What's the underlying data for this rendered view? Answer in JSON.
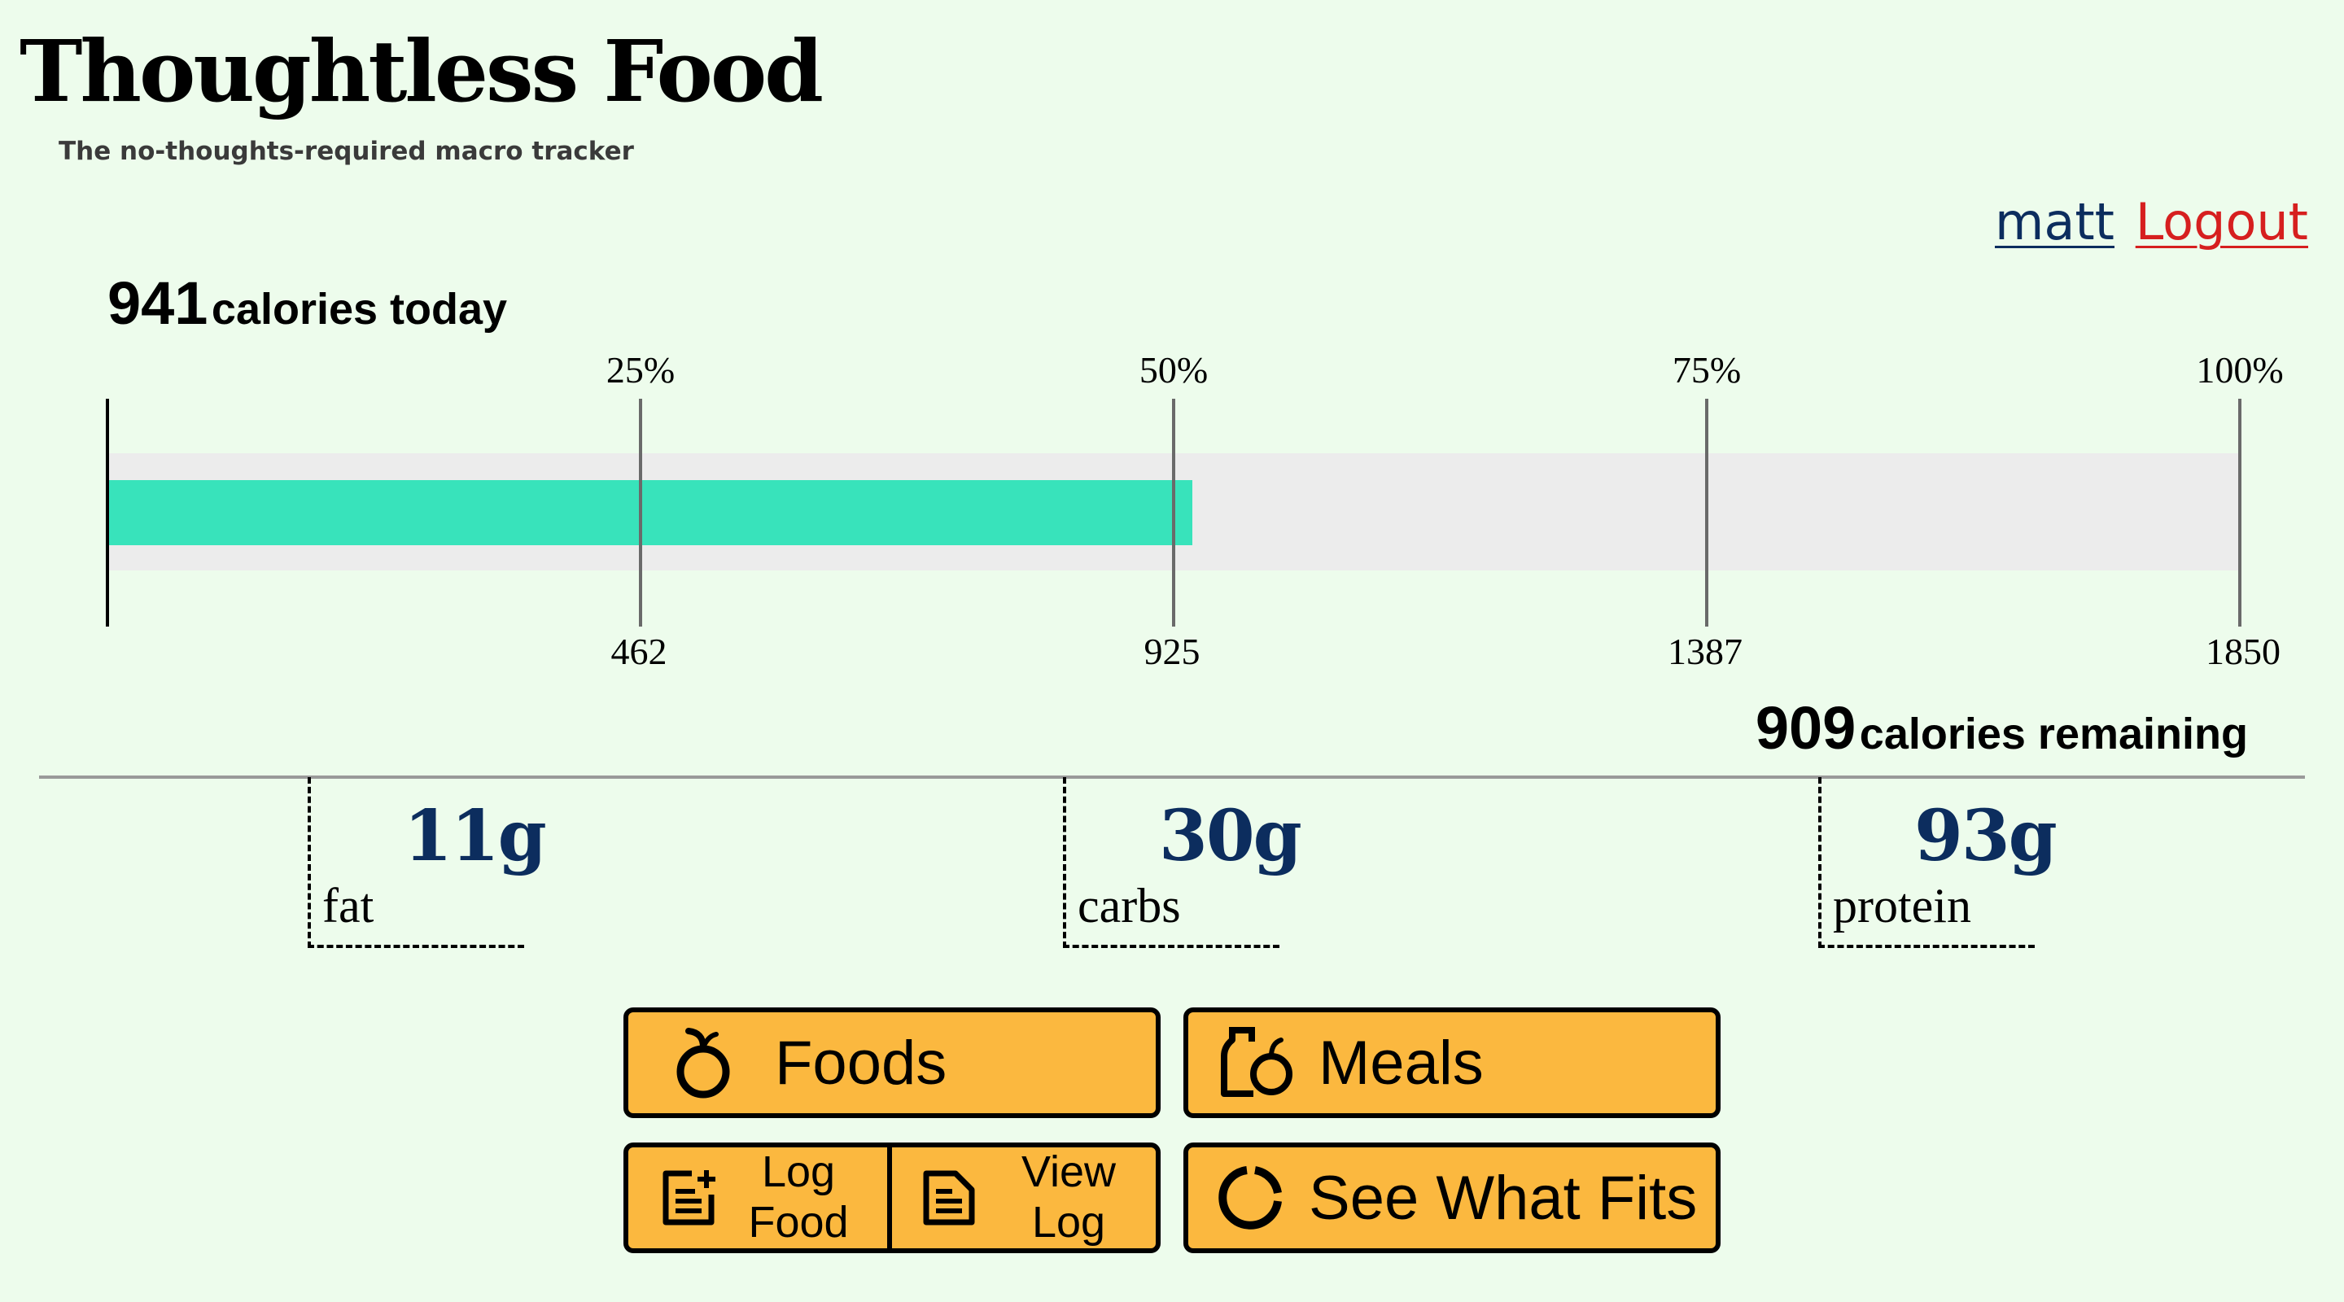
{
  "header": {
    "title": "Thoughtless Food",
    "subtitle": "The no-thoughts-required macro tracker"
  },
  "nav": {
    "user": "matt",
    "logout": "Logout"
  },
  "calories": {
    "today_value": "941",
    "today_suffix": "calories today",
    "remaining_value": "909",
    "remaining_suffix": "calories remaining",
    "goal": 1850,
    "consumed": 941,
    "percent_labels": [
      "25%",
      "50%",
      "75%",
      "100%"
    ],
    "value_labels": [
      "462",
      "925",
      "1387",
      "1850"
    ]
  },
  "macros": [
    {
      "value": "11g",
      "name": "fat"
    },
    {
      "value": "30g",
      "name": "carbs"
    },
    {
      "value": "93g",
      "name": "protein"
    }
  ],
  "buttons": {
    "foods": "Foods",
    "meals": "Meals",
    "log_food_1": "Log",
    "log_food_2": "Food",
    "view_log_1": "View",
    "view_log_2": "Log",
    "see_what_fits": "See What Fits"
  },
  "colors": {
    "background": "#edfcec",
    "progress_fill": "#38e3bb",
    "progress_track": "#ececec",
    "button": "#fbb83f",
    "macro_value": "#0c2d5e",
    "logout": "#d61f1f",
    "user": "#0c2d5e"
  },
  "icons": {
    "foods": "apple-icon",
    "meals": "meal-icon",
    "log_food": "note-add-icon",
    "view_log": "document-icon",
    "see_what_fits": "donut-chart-icon"
  }
}
